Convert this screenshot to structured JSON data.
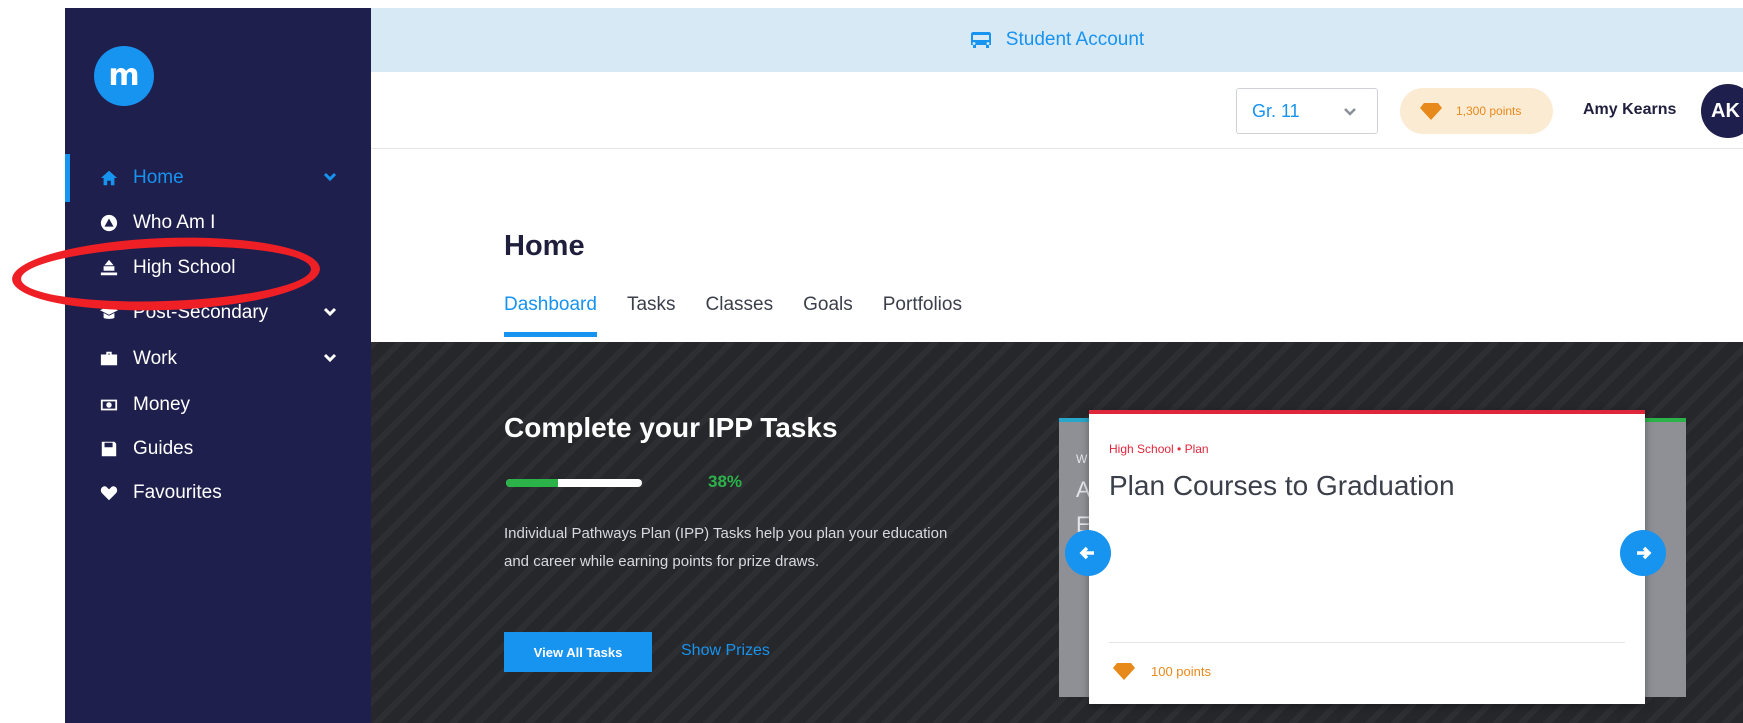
{
  "app": {
    "logo_letter": "m"
  },
  "banner": {
    "label": "Student Account",
    "icon": "bus-icon"
  },
  "header": {
    "grade": "Gr. 11",
    "points": "1,300 points",
    "user_name": "Amy Kearns",
    "avatar_initials": "AK"
  },
  "sidebar": {
    "items": [
      {
        "label": "Home",
        "icon": "home-icon",
        "has_chevron": true,
        "active": true
      },
      {
        "label": "Who Am I",
        "icon": "person-circle-icon",
        "has_chevron": false
      },
      {
        "label": "High School",
        "icon": "school-icon",
        "has_chevron": false
      },
      {
        "label": "Post-Secondary",
        "icon": "graduation-cap-icon",
        "has_chevron": true
      },
      {
        "label": "Work",
        "icon": "briefcase-icon",
        "has_chevron": true
      },
      {
        "label": "Money",
        "icon": "money-icon",
        "has_chevron": false
      },
      {
        "label": "Guides",
        "icon": "guide-book-icon",
        "has_chevron": false
      },
      {
        "label": "Favourites",
        "icon": "heart-icon",
        "has_chevron": false
      }
    ],
    "highlighted_item": "High School",
    "highlight_color": "#ee1f25"
  },
  "page": {
    "title": "Home",
    "tabs": [
      {
        "label": "Dashboard",
        "active": true
      },
      {
        "label": "Tasks"
      },
      {
        "label": "Classes"
      },
      {
        "label": "Goals"
      },
      {
        "label": "Portfolios"
      }
    ]
  },
  "hero": {
    "title": "Complete your IPP Tasks",
    "progress_percent": 38,
    "progress_label": "38%",
    "description": "Individual Pathways Plan (IPP) Tasks help you plan your education and career while earning points for prize draws.",
    "primary_button": "View All Tasks",
    "secondary_link": "Show Prizes"
  },
  "carousel": {
    "prev_peek": [
      "W",
      "A",
      "E"
    ],
    "card": {
      "category": "High School • Plan",
      "title": "Plan Courses to Graduation",
      "points": "100 points"
    }
  },
  "colors": {
    "sidebar_bg": "#1f1f4d",
    "accent": "#1793f0",
    "points_orange": "#e8891b",
    "progress_green": "#2bb34a"
  }
}
